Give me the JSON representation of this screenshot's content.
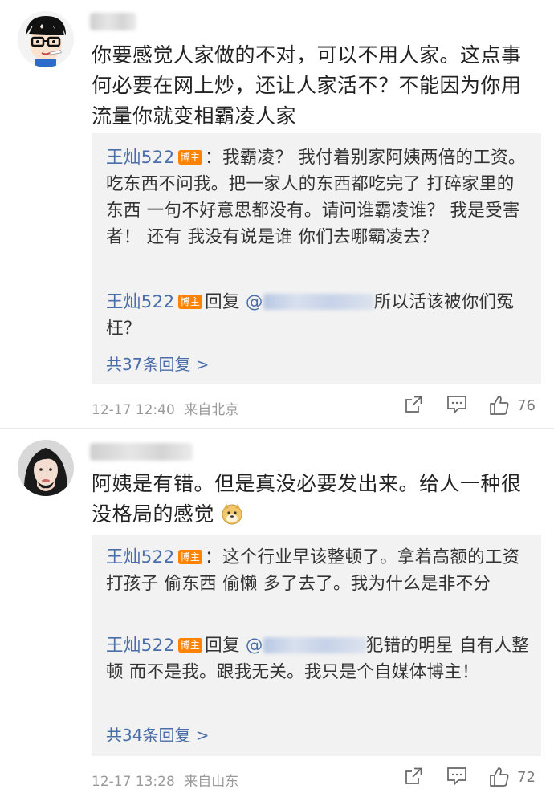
{
  "comments": [
    {
      "text": "你要感觉人家做的不对，可以不用人家。这点事何必要在网上炒，还让人家活不？不能因为你用流量你就变相霸凌人家",
      "replies": [
        {
          "author": "王灿522",
          "badge": "博主",
          "content": "：我霸凌？ 我付着别家阿姨两倍的工资。吃东西不问我。把一家人的东西都吃完了 打碎家里的东西 一句不好意思都没有。请问谁霸凌谁？ 我是受害者！ 还有 我没有说是谁 你们去哪霸凌去？"
        },
        {
          "author": "王灿522",
          "badge": "博主",
          "prefix": "回复",
          "mention_visible": "@",
          "content": "所以活该被你们冤枉？"
        }
      ],
      "more_replies": "共37条回复 >",
      "time": "12-17 12:40",
      "source": "来自北京",
      "likes": "76"
    },
    {
      "text": "阿姨是有错。但是真没必要发出来。给人一种很没格局的感觉",
      "emoji": "doge-emoji",
      "replies": [
        {
          "author": "王灿522",
          "badge": "博主",
          "content": "：这个行业早该整顿了。拿着高额的工资 打孩子 偷东西 偷懒 多了去了。我为什么是非不分"
        },
        {
          "author": "王灿522",
          "badge": "博主",
          "prefix": "回复",
          "mention_visible": "@",
          "content": "犯错的明星 自有人整顿 而不是我。跟我无关。我只是个自媒体博主！"
        }
      ],
      "more_replies": "共34条回复 >",
      "time": "12-17 13:28",
      "source": "来自山东",
      "likes": "72"
    }
  ],
  "icons": [
    "share-icon",
    "comment-icon",
    "like-icon"
  ]
}
